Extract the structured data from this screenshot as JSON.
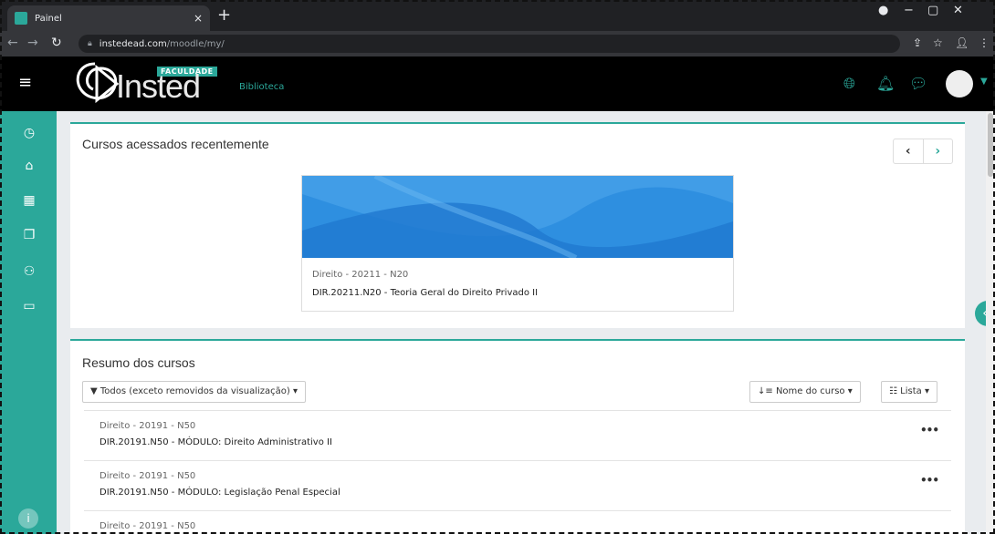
{
  "browser": {
    "tab_title": "Painel",
    "tab_close": "×",
    "new_tab": "+",
    "url_host": "instedead.com",
    "url_path": "/moodle/my/"
  },
  "header": {
    "logo_text": "Insted",
    "logo_badge": "FACULDADE",
    "nav_link": "Biblioteca",
    "icons": [
      "globe-icon",
      "bell-icon",
      "chat-icon"
    ]
  },
  "sidebar": {
    "items": [
      "dashboard-icon",
      "home-icon",
      "calendar-icon",
      "files-icon",
      "courses-icon",
      "folder-icon"
    ],
    "info": "i"
  },
  "recent": {
    "title": "Cursos acessados recentemente",
    "prev": "‹",
    "next": "›",
    "course": {
      "category": "Direito - 20211 - N20",
      "name": "DIR.20211.N20 - Teoria Geral do Direito Privado II"
    }
  },
  "overview": {
    "title": "Resumo dos cursos",
    "filter_label": "Todos (exceto removidos da visualização)",
    "sort_label": "Nome do curso",
    "view_label": "Lista",
    "items": [
      {
        "category": "Direito - 20191 - N50",
        "name": "DIR.20191.N50 - MÓDULO: Direito Administrativo II"
      },
      {
        "category": "Direito - 20191 - N50",
        "name": "DIR.20191.N50 - MÓDULO: Legislação Penal Especial"
      },
      {
        "category": "Direito - 20191 - N50",
        "name": ""
      }
    ],
    "item_menu": "•••"
  }
}
